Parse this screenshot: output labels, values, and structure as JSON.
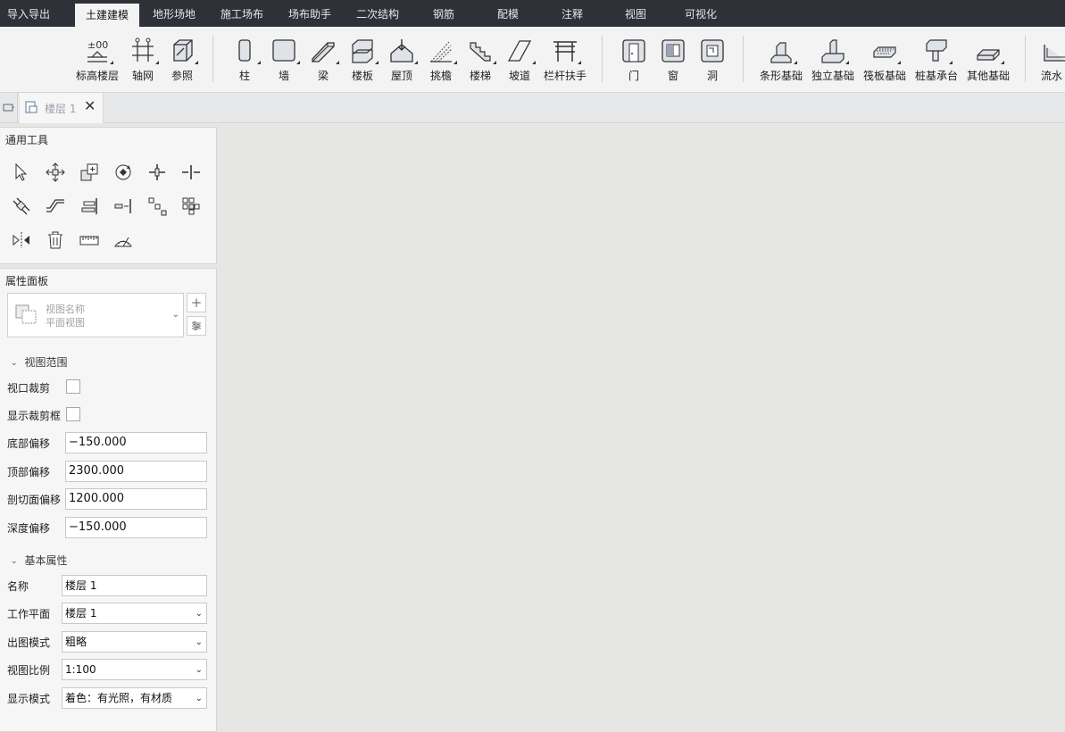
{
  "menu_tabs": [
    "导入导出",
    "土建建模",
    "地形场地",
    "施工场布",
    "场布助手",
    "二次结构",
    "钢筋",
    "配模",
    "注释",
    "视图",
    "可视化"
  ],
  "active_menu_tab": "土建建模",
  "ribbon": {
    "level": "标高楼层",
    "axis": "轴网",
    "reference": "参照",
    "column": "柱",
    "wall": "墙",
    "beam": "梁",
    "slab": "楼板",
    "roof": "屋顶",
    "eave": "挑檐",
    "stair": "楼梯",
    "ramp": "坡道",
    "railing": "栏杆扶手",
    "door": "门",
    "window": "窗",
    "opening": "洞",
    "strip_foundation": "条形基础",
    "isolated_foundation": "独立基础",
    "raft_foundation": "筏板基础",
    "pile_cap": "桩基承台",
    "other_foundation": "其他基础",
    "drain": "流水"
  },
  "doc_tab": {
    "label": "楼层 1",
    "close": "✕"
  },
  "tools_panel": {
    "title": "通用工具"
  },
  "props_panel": {
    "title": "属性面板",
    "view_name_label": "视图名称",
    "view_name_value": "平面视图",
    "add_symbol": "+",
    "view_range": {
      "title": "视图范围",
      "viewport_crop": "视口裁剪",
      "show_crop_frame": "显示裁剪框",
      "bottom_offset_label": "底部偏移",
      "bottom_offset": "−150.000",
      "top_offset_label": "顶部偏移",
      "top_offset": "2300.000",
      "cut_offset_label": "剖切面偏移",
      "cut_offset": "1200.000",
      "depth_offset_label": "深度偏移",
      "depth_offset": "−150.000"
    },
    "basic": {
      "title": "基本属性",
      "name_label": "名称",
      "name": "楼层 1",
      "work_plane_label": "工作平面",
      "work_plane": "楼层 1",
      "output_mode_label": "出图模式",
      "output_mode": "粗略",
      "scale_label": "视图比例",
      "scale": "1:100",
      "display_mode_label": "显示模式",
      "display_mode": "着色：有光照，有材质"
    }
  },
  "colors": {
    "menubar": "#2e3138",
    "ribbon": "#f3f3f3",
    "canvas": "#e6e6e4"
  }
}
